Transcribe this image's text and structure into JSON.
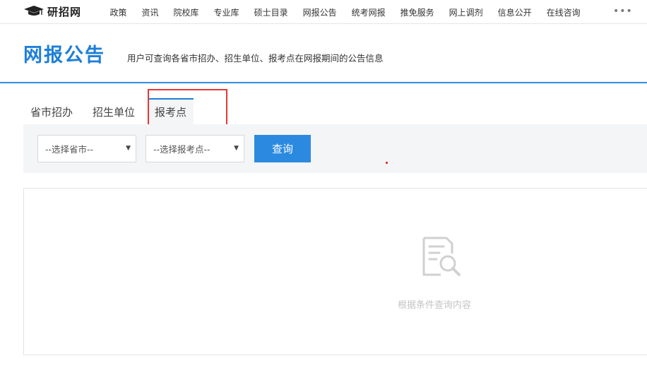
{
  "brand": {
    "name": "研招网"
  },
  "nav": {
    "items": [
      "政策",
      "资讯",
      "院校库",
      "专业库",
      "硕士目录",
      "网报公告",
      "统考网报",
      "推免服务",
      "网上调剂",
      "信息公开",
      "在线咨询"
    ],
    "more": "•••"
  },
  "header": {
    "title": "网报公告",
    "subtitle": "用户可查询各省市招办、招生单位、报考点在网报期间的公告信息"
  },
  "tabs": [
    {
      "label": "省市招办",
      "active": false
    },
    {
      "label": "招生单位",
      "active": false
    },
    {
      "label": "报考点",
      "active": true
    }
  ],
  "filters": {
    "province_select": "--选择省市--",
    "site_select": "--选择报考点--",
    "caret": "▼",
    "query_button": "查询"
  },
  "results": {
    "empty_text": "根据条件查询内容",
    "empty_icon": "document-search-icon"
  },
  "colors": {
    "accent": "#1d7fd8",
    "button": "#2b8ae0",
    "highlight": "#e53935"
  }
}
